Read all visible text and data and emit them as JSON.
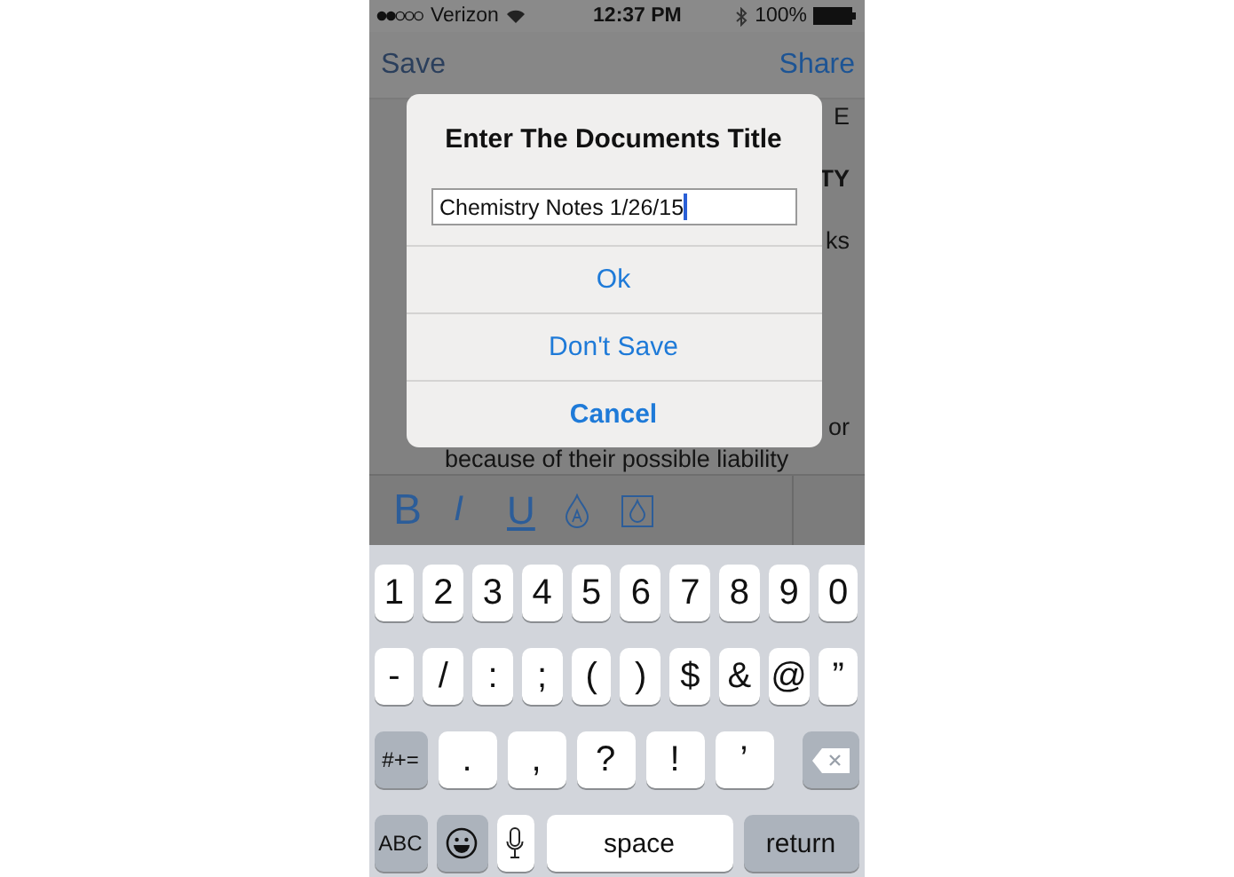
{
  "status_bar": {
    "carrier": "Verizon",
    "time": "12:37 PM",
    "battery": "100%"
  },
  "nav": {
    "left": "Save",
    "right": "Share"
  },
  "document": {
    "lines": [
      {
        "text": "E",
        "bold": false,
        "under_dialog": true
      },
      {
        "text": "TY",
        "bold": true,
        "under_dialog": true
      },
      {
        "text": "ks",
        "bold": false,
        "under_dialog": true
      },
      {
        "text": "or",
        "bold": false,
        "under_dialog": true
      },
      {
        "text": "because of their possible liability",
        "bold": false,
        "under_dialog": false
      }
    ]
  },
  "format_toolbar": [
    {
      "kind": "bold",
      "label": "B"
    },
    {
      "kind": "italic",
      "label": "I"
    },
    {
      "kind": "underline",
      "label": "U"
    },
    {
      "kind": "text-color"
    },
    {
      "kind": "highlight"
    }
  ],
  "dialog": {
    "title": "Enter The Documents Title",
    "field": {
      "value": "Chemistry Notes 1/26/15"
    },
    "buttons": [
      {
        "label": "Ok",
        "bold": false
      },
      {
        "label": "Don't Save",
        "bold": false
      },
      {
        "label": "Cancel",
        "bold": true
      }
    ]
  },
  "keyboard": {
    "key_rows": [
      {
        "keys": [
          {
            "kind": "char",
            "label": "1"
          },
          {
            "kind": "char",
            "label": "2"
          },
          {
            "kind": "char",
            "label": "3"
          },
          {
            "kind": "char",
            "label": "4"
          },
          {
            "kind": "char",
            "label": "5"
          },
          {
            "kind": "char",
            "label": "6"
          },
          {
            "kind": "char",
            "label": "7"
          },
          {
            "kind": "char",
            "label": "8"
          },
          {
            "kind": "char",
            "label": "9"
          },
          {
            "kind": "char",
            "label": "0"
          }
        ]
      },
      {
        "keys": [
          {
            "kind": "char",
            "label": "-"
          },
          {
            "kind": "char",
            "label": "/"
          },
          {
            "kind": "char",
            "label": ":"
          },
          {
            "kind": "char",
            "label": ";"
          },
          {
            "kind": "char",
            "label": "("
          },
          {
            "kind": "char",
            "label": ")"
          },
          {
            "kind": "char",
            "label": "$"
          },
          {
            "kind": "char",
            "label": "&"
          },
          {
            "kind": "char",
            "label": "@"
          },
          {
            "kind": "char",
            "label": "”"
          }
        ]
      },
      {
        "keys": [
          {
            "kind": "mode",
            "label": "#+="
          },
          {
            "kind": "wide",
            "label": "."
          },
          {
            "kind": "wide",
            "label": ","
          },
          {
            "kind": "wide",
            "label": "?"
          },
          {
            "kind": "wide",
            "label": "!"
          },
          {
            "kind": "wide",
            "label": "’"
          },
          {
            "kind": "delete"
          }
        ]
      },
      {
        "keys": [
          {
            "kind": "mode",
            "label": "ABC"
          },
          {
            "kind": "emoji"
          },
          {
            "kind": "mic"
          },
          {
            "kind": "space",
            "label": "space"
          },
          {
            "kind": "return",
            "label": "return"
          }
        ]
      }
    ]
  }
}
